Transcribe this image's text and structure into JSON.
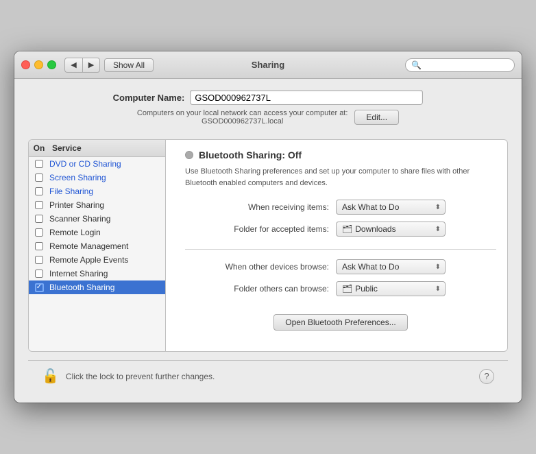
{
  "window": {
    "title": "Sharing"
  },
  "titlebar": {
    "back_label": "◀",
    "forward_label": "▶",
    "show_all_label": "Show All",
    "search_placeholder": ""
  },
  "computer_name": {
    "label": "Computer Name:",
    "value": "GSOD000962737L",
    "info_line1": "Computers on your local network can access your computer at:",
    "info_line2": "GSOD000962737L.local",
    "local_link": "local",
    "edit_label": "Edit..."
  },
  "services": {
    "col_on": "On",
    "col_service": "Service",
    "items": [
      {
        "name": "DVD or CD Sharing",
        "checked": false,
        "selected": false
      },
      {
        "name": "Screen Sharing",
        "checked": false,
        "selected": false
      },
      {
        "name": "File Sharing",
        "checked": false,
        "selected": false
      },
      {
        "name": "Printer Sharing",
        "checked": false,
        "selected": false
      },
      {
        "name": "Scanner Sharing",
        "checked": false,
        "selected": false
      },
      {
        "name": "Remote Login",
        "checked": false,
        "selected": false
      },
      {
        "name": "Remote Management",
        "checked": false,
        "selected": false
      },
      {
        "name": "Remote Apple Events",
        "checked": false,
        "selected": false
      },
      {
        "name": "Internet Sharing",
        "checked": false,
        "selected": false
      },
      {
        "name": "Bluetooth Sharing",
        "checked": true,
        "selected": true
      }
    ]
  },
  "detail": {
    "title": "Bluetooth Sharing: Off",
    "description": "Use Bluetooth Sharing preferences and set up your computer to share files\nwith other Bluetooth enabled computers and devices.",
    "when_receiving_label": "When receiving items:",
    "when_receiving_value": "Ask What to Do",
    "folder_accepted_label": "Folder for accepted items:",
    "folder_accepted_icon": "🗂",
    "folder_accepted_value": "Downloads",
    "when_browse_label": "When other devices browse:",
    "when_browse_value": "Ask What to Do",
    "folder_browse_label": "Folder others can browse:",
    "folder_browse_icon": "🗂",
    "folder_browse_value": "Public",
    "open_prefs_label": "Open Bluetooth Preferences..."
  },
  "bottom": {
    "lock_text": "Click the lock to prevent further changes.",
    "help_label": "?"
  }
}
